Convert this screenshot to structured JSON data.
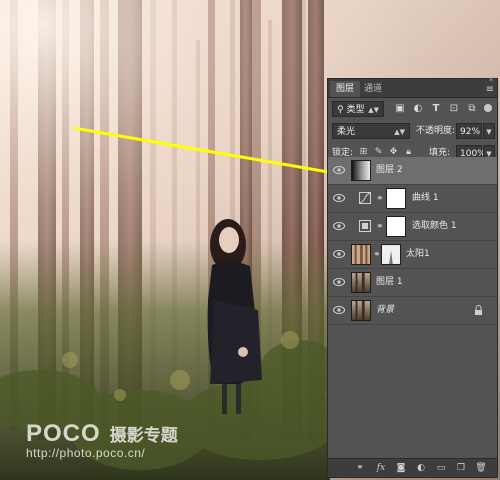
{
  "watermark": {
    "brand": "POCO",
    "brand_cn": "摄影专题",
    "url": "http://photo.poco.cn/"
  },
  "panel": {
    "tabs": [
      "图层",
      "通道"
    ],
    "filter": {
      "kind_label": "类型",
      "icons": [
        "image-filter-icon",
        "adjustment-filter-icon",
        "type-filter-icon",
        "shape-filter-icon",
        "smart-object-filter-icon"
      ]
    },
    "blend": {
      "mode": "柔光",
      "opacity_label": "不透明度:",
      "opacity_value": "92%"
    },
    "lock": {
      "label": "锁定:",
      "fill_label": "填充:",
      "fill_value": "100%"
    },
    "layers": [
      {
        "name": "图层 2",
        "type": "pixel",
        "selected": true
      },
      {
        "name": "曲线 1",
        "type": "curves",
        "selected": false
      },
      {
        "name": "选取颜色 1",
        "type": "selective-color",
        "selected": false
      },
      {
        "name": "太阳1",
        "type": "pixel-mask",
        "selected": false
      },
      {
        "name": "图层 1",
        "type": "pixel",
        "selected": false
      },
      {
        "name": "背景",
        "type": "background",
        "selected": false
      }
    ],
    "footer_icons": [
      "link-layers-icon",
      "fx-icon",
      "add-mask-icon",
      "adjustment-layer-icon",
      "group-folder-icon",
      "new-layer-icon",
      "trash-icon"
    ]
  },
  "colors": {
    "panel_bg": "#535353",
    "selected_row": "#6e6e6e",
    "arrow": "#ffff00"
  }
}
